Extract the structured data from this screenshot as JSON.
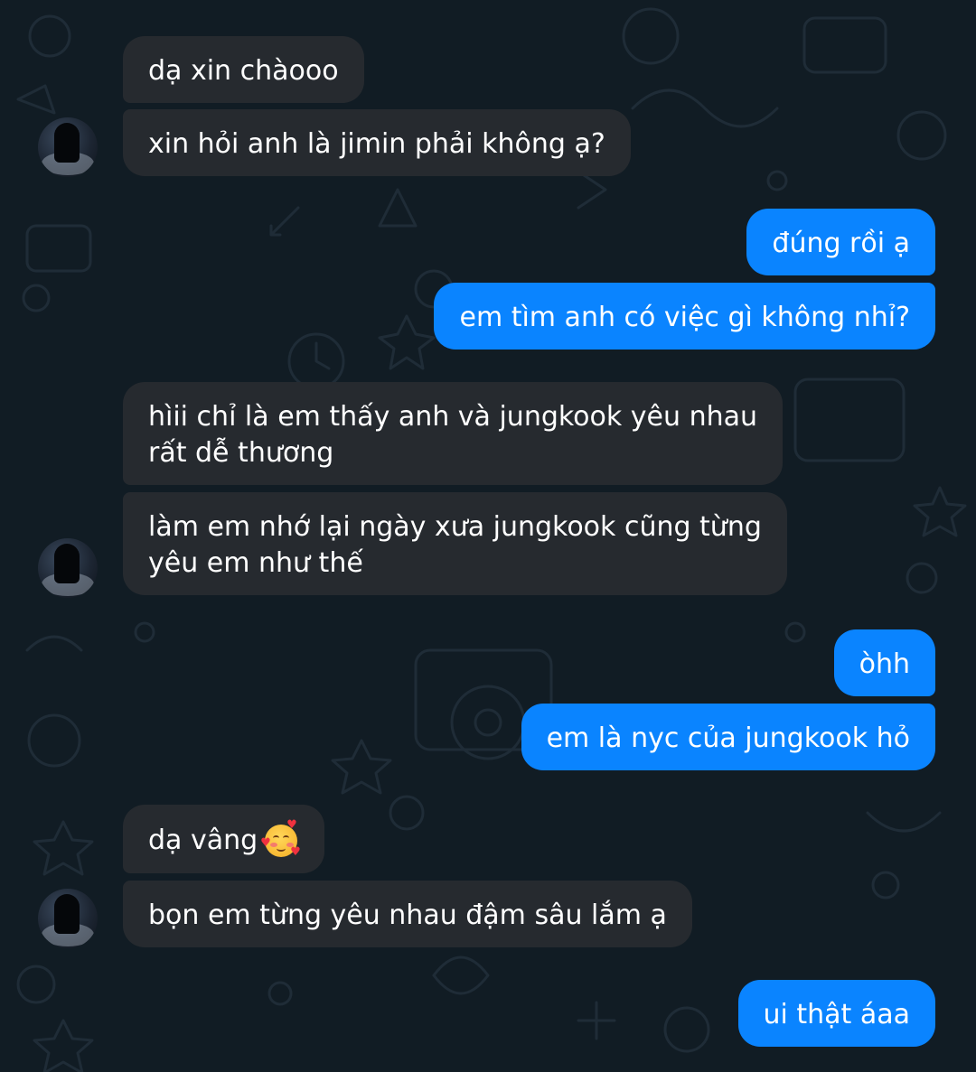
{
  "messages": [
    {
      "side": "in",
      "text": "dạ xin chàooo"
    },
    {
      "side": "in",
      "text": "xin hỏi anh là jimin phải không ạ?"
    },
    {
      "side": "out",
      "text": "đúng rồi ạ"
    },
    {
      "side": "out",
      "text": "em tìm anh có việc gì không nhỉ?"
    },
    {
      "side": "in",
      "line1": "hìii chỉ là em thấy anh và jungkook yêu nhau",
      "line2": "rất dễ thương"
    },
    {
      "side": "in",
      "line1": "làm em nhớ lại ngày xưa jungkook cũng từng",
      "line2": "yêu em như thế"
    },
    {
      "side": "out",
      "text": "òhh"
    },
    {
      "side": "out",
      "text": "em là nyc của jungkook hỏ"
    },
    {
      "side": "in",
      "text": "dạ vâng",
      "emoji": "smiling-face-with-hearts-icon"
    },
    {
      "side": "in",
      "text": "bọn em từng yêu nhau đậm sâu lắm ạ"
    },
    {
      "side": "out",
      "text": "ui thật áaa"
    }
  ],
  "colors": {
    "background": "#111c24",
    "incoming_bubble": "#262a2f",
    "outgoing_bubble": "#0a84ff",
    "text": "#ffffff"
  }
}
